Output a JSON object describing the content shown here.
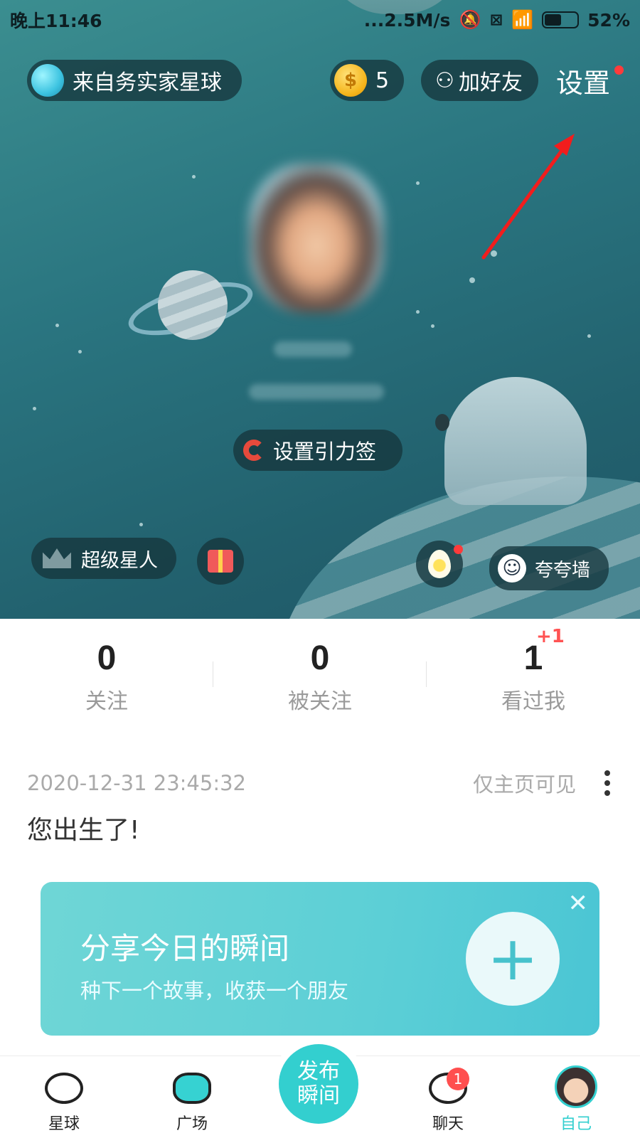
{
  "status_bar": {
    "time": "晚上11:46",
    "net_speed": "...2.5M/s",
    "battery": "52%",
    "battery_level": 0.52,
    "icons": [
      "mute-icon",
      "sim-off-icon",
      "wifi-icon",
      "battery-icon"
    ]
  },
  "header": {
    "planet_label": "来自务实家星球",
    "coin_count": "5",
    "add_friend": "加好友",
    "settings": "设置"
  },
  "profile": {
    "gravity_tag": "设置引力签",
    "super_star": "超级星人",
    "praise_wall": "夸夸墙"
  },
  "stats": [
    {
      "value": "0",
      "label": "关注"
    },
    {
      "value": "0",
      "label": "被关注"
    },
    {
      "value": "1",
      "label": "看过我",
      "delta": "+1"
    }
  ],
  "post": {
    "timestamp": "2020-12-31 23:45:32",
    "visibility": "仅主页可见",
    "text": "您出生了!"
  },
  "share_card": {
    "title": "分享今日的瞬间",
    "subtitle": "种下一个故事，收获一个朋友"
  },
  "tabbar": {
    "items": [
      {
        "label": "星球"
      },
      {
        "label": "广场"
      },
      {
        "label": "聊天",
        "badge": "1"
      },
      {
        "label": "自己"
      }
    ],
    "publish_line1": "发布",
    "publish_line2": "瞬间"
  },
  "colors": {
    "accent": "#33cfcf",
    "badge_red": "#ff4f4f",
    "hero_bg": "#2a7580"
  }
}
